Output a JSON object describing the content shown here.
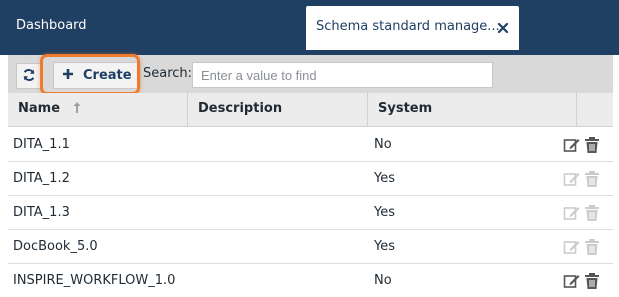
{
  "tabs": {
    "dashboard": "Dashboard",
    "active": "Schema standard manage..."
  },
  "toolbar": {
    "create_label": "Create",
    "search_label": "Search:",
    "search_placeholder": "Enter a value to find"
  },
  "table": {
    "columns": [
      "Name",
      "Description",
      "System"
    ],
    "rows": [
      {
        "name": "DITA_1.1",
        "description": "",
        "system": "No",
        "actions_enabled": true
      },
      {
        "name": "DITA_1.2",
        "description": "",
        "system": "Yes",
        "actions_enabled": false
      },
      {
        "name": "DITA_1.3",
        "description": "",
        "system": "Yes",
        "actions_enabled": false
      },
      {
        "name": "DocBook_5.0",
        "description": "",
        "system": "Yes",
        "actions_enabled": false
      },
      {
        "name": "INSPIRE_WORKFLOW_1.0",
        "description": "",
        "system": "No",
        "actions_enabled": true
      }
    ]
  },
  "colors": {
    "header_bg": "#1f3f63",
    "highlight": "#ef7b2e",
    "toolbar_bg": "#d9d9d9"
  },
  "icons": {
    "refresh": "refresh-icon",
    "create": "plus-icon",
    "close": "close-icon",
    "sort": "sort-up-icon",
    "edit": "edit-icon",
    "delete": "trash-icon"
  }
}
